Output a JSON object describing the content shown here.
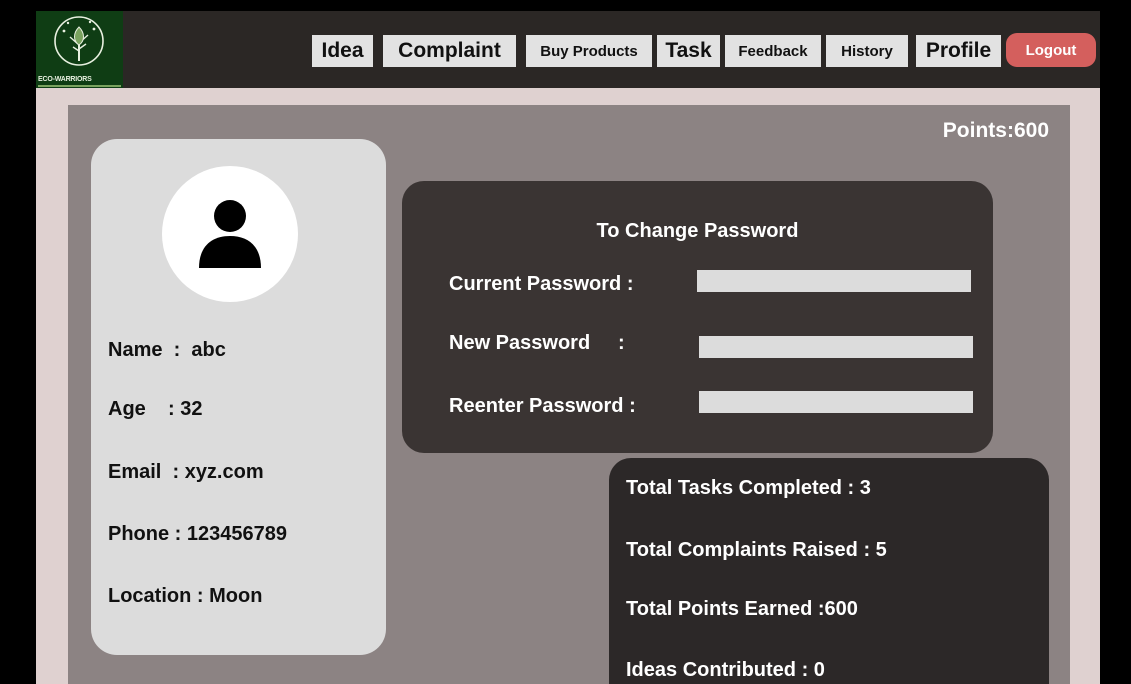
{
  "app": {
    "logo_text": "ECO-WARRIORS"
  },
  "nav": {
    "items": [
      "Idea",
      "Complaint",
      "Buy Products",
      "Task",
      "Feedback",
      "History",
      "Profile"
    ],
    "logout": "Logout"
  },
  "points_label": "Points:600",
  "profile": {
    "avatar_icon": "user-icon",
    "name": "Name  :  abc",
    "age": "Age    : 32",
    "email": "Email  : xyz.com",
    "phone": "Phone : 123456789",
    "location": "Location : Moon"
  },
  "password": {
    "title": "To Change Password",
    "current_label": "Current Password :",
    "new_label": "New Password     :",
    "reenter_label": "Reenter Password :",
    "current_value": "",
    "new_value": "",
    "reenter_value": ""
  },
  "stats": {
    "tasks": "Total Tasks Completed : 3",
    "complaints": "Total Complaints Raised : 5",
    "points": "Total Points Earned :600",
    "ideas": "Ideas Contributed : 0"
  },
  "colors": {
    "logout": "#d45f5d",
    "logo_bg": "#0f3d14",
    "panel": "#8c8383"
  }
}
